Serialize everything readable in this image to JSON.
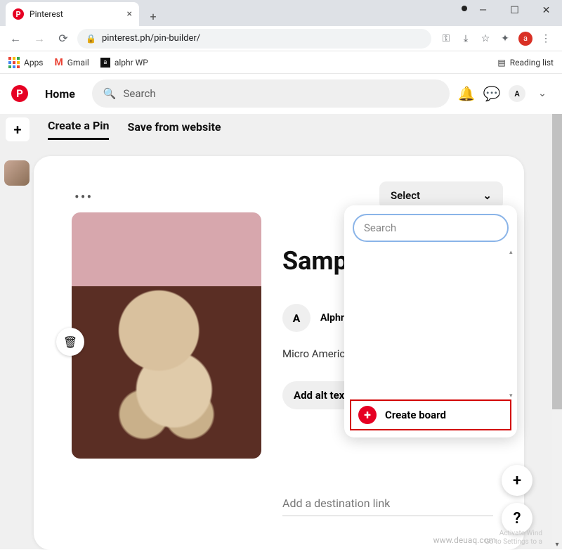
{
  "browser": {
    "tab_title": "Pinterest",
    "url": "pinterest.ph/pin-builder/",
    "profile_initial": "a",
    "bookmarks": {
      "apps": "Apps",
      "gmail": "Gmail",
      "alphr": "alphr WP",
      "reading_list": "Reading list"
    }
  },
  "pinterest_header": {
    "home": "Home",
    "search_placeholder": "Search",
    "avatar_initial": "A"
  },
  "builder_tabs": {
    "create": "Create a Pin",
    "save_web": "Save from website"
  },
  "pin": {
    "select_label": "Select",
    "title": "Sample",
    "author_initial": "A",
    "author_name": "Alphrdelle",
    "description": "Micro American B",
    "alt_button": "Add alt text",
    "destination_placeholder": "Add a destination link"
  },
  "dropdown": {
    "search_placeholder": "Search",
    "create_board": "Create board"
  },
  "fab": {
    "plus": "+",
    "help": "?"
  },
  "watermark": "www.deuaq.com",
  "win_watermark_line1": "Activate Wind",
  "win_watermark_line2": "Go to Settings to a"
}
